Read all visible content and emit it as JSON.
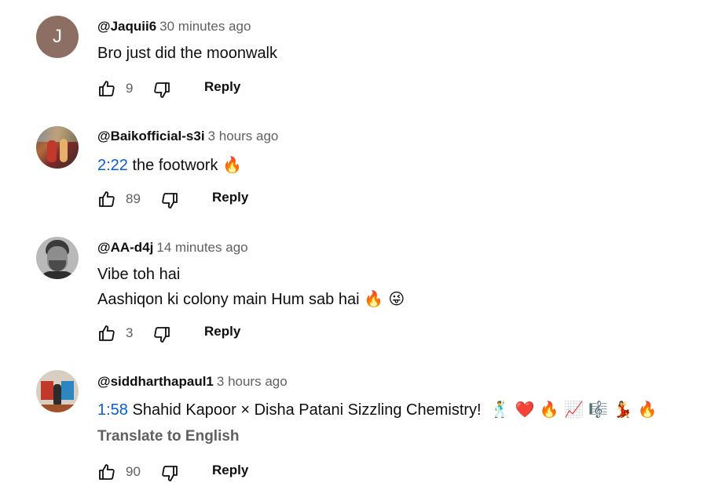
{
  "comments": [
    {
      "author": "@Jaquii6",
      "time": "30 minutes ago",
      "avatar_letter": "J",
      "lines": [
        "Bro just did the moonwalk"
      ],
      "likes": "9",
      "reply_label": "Reply"
    },
    {
      "author": "@Baikofficial-s3i",
      "time": "3 hours ago",
      "timestamp": "2:22",
      "text": "the footwork",
      "emojis": "🔥",
      "likes": "89",
      "reply_label": "Reply"
    },
    {
      "author": "@AA-d4j",
      "time": "14 minutes ago",
      "line1": "Vibe toh hai",
      "line2": "Aashiqon ki colony main Hum sab hai",
      "emojis": "🔥 😜",
      "likes": "3",
      "reply_label": "Reply"
    },
    {
      "author": "@siddharthapaul1",
      "time": "3 hours ago",
      "timestamp": "1:58",
      "text": "Shahid Kapoor × Disha Patani Sizzling Chemistry!",
      "emojis": "🕺 ❤️ 🔥 📈 🎼 💃 🔥",
      "translate_label": "Translate to English",
      "likes": "90",
      "reply_label": "Reply"
    }
  ],
  "icons": {
    "like": "thumbs-up-icon",
    "dislike": "thumbs-down-icon"
  },
  "colors": {
    "link": "#065fd4",
    "secondary_text": "#606060",
    "avatar_j": "#8d6e63"
  }
}
